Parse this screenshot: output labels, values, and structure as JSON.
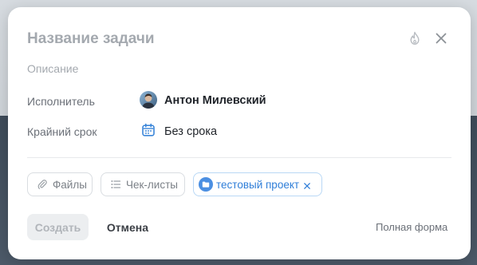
{
  "modal": {
    "title_placeholder": "Название задачи",
    "description_placeholder": "Описание",
    "icons": {
      "priority": "flame-icon",
      "close": "close-icon"
    }
  },
  "fields": {
    "assignee": {
      "label": "Исполнитель",
      "name": "Антон Милевский",
      "avatar": "user-avatar"
    },
    "deadline": {
      "label": "Крайний срок",
      "value": "Без срока",
      "icon": "calendar-icon"
    }
  },
  "chips": {
    "files": {
      "label": "Файлы",
      "icon": "paperclip-icon"
    },
    "checklists": {
      "label": "Чек-листы",
      "icon": "checklist-icon"
    },
    "project": {
      "label": "тестовый проект",
      "icon": "folder-icon",
      "remove_icon": "remove-icon"
    }
  },
  "footer": {
    "create_label": "Создать",
    "cancel_label": "Отмена",
    "full_form_label": "Полная форма"
  },
  "colors": {
    "accent": "#2f7ed8",
    "project_icon_bg": "#4b8fe2",
    "text_primary": "#1f2329",
    "text_muted": "#6b7078",
    "placeholder": "#a4a9af",
    "disabled_button_bg": "#eceef0"
  }
}
